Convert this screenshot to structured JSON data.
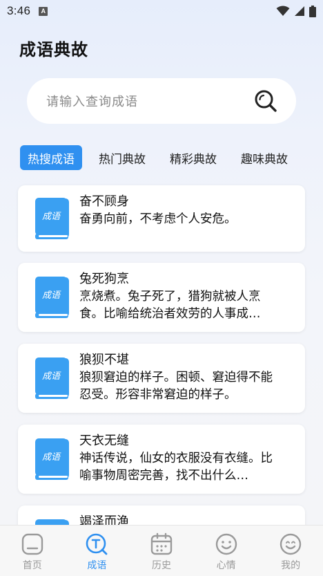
{
  "status_bar": {
    "time": "3:46",
    "badge": "A"
  },
  "header": {
    "title": "成语典故"
  },
  "search": {
    "placeholder": "请输入查询成语"
  },
  "tabs": [
    {
      "label": "热搜成语",
      "active": true
    },
    {
      "label": "热门典故",
      "active": false
    },
    {
      "label": "精彩典故",
      "active": false
    },
    {
      "label": "趣味典故",
      "active": false
    }
  ],
  "book_icon_text": "成语",
  "idioms": [
    {
      "title": "奋不顾身",
      "desc": "奋勇向前，不考虑个人安危。"
    },
    {
      "title": "兔死狗烹",
      "desc": "烹烧煮。兔子死了，猎狗就被人烹食。比喻给统治者效劳的人事成…"
    },
    {
      "title": "狼狈不堪",
      "desc": "狼狈窘迫的样子。困顿、窘迫得不能忍受。形容非常窘迫的样子。"
    },
    {
      "title": "天衣无缝",
      "desc": "神话传说，仙女的衣服没有衣缝。比喻事物周密完善，找不出什么…"
    },
    {
      "title": "竭泽而渔",
      "desc": ""
    }
  ],
  "nav": [
    {
      "label": "首页",
      "icon": "home-icon",
      "active": false
    },
    {
      "label": "成语",
      "icon": "idiom-icon",
      "active": true
    },
    {
      "label": "历史",
      "icon": "calendar-icon",
      "active": false
    },
    {
      "label": "心情",
      "icon": "smile-icon",
      "active": false
    },
    {
      "label": "我的",
      "icon": "user-icon",
      "active": false
    }
  ],
  "colors": {
    "accent": "#2f90f0",
    "book_blue": "#3aa0f2",
    "nav_inactive": "#9a9a9a"
  }
}
